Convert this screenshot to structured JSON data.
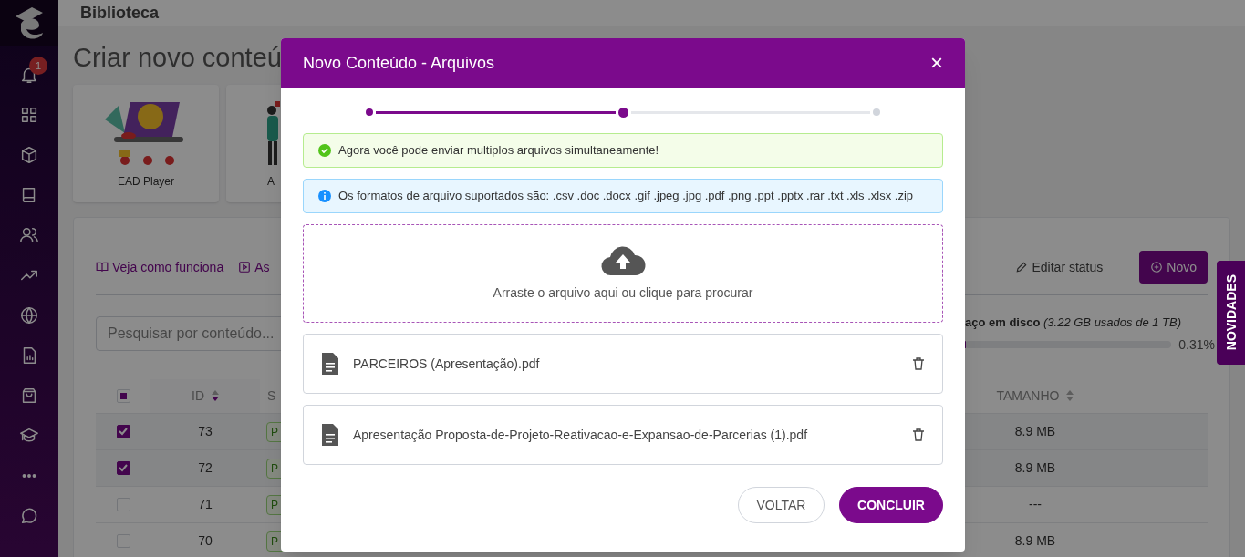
{
  "sidebar": {
    "notification_badge": "1",
    "items": [
      {
        "kind": "bell"
      },
      {
        "kind": "grid"
      },
      {
        "kind": "cube"
      },
      {
        "kind": "book"
      },
      {
        "kind": "users"
      },
      {
        "kind": "trend"
      },
      {
        "kind": "globe"
      },
      {
        "kind": "report"
      },
      {
        "kind": "bag"
      },
      {
        "kind": "cap"
      },
      {
        "kind": "dots"
      },
      {
        "kind": "chat"
      }
    ]
  },
  "header": {
    "title": "Biblioteca"
  },
  "page_title": "Criar novo conteú",
  "cards": [
    {
      "label": "EAD Player",
      "kind": "picture"
    },
    {
      "label": "A",
      "kind": "picture"
    }
  ],
  "toolbar": {
    "links": [
      "Veja como funciona",
      "As"
    ],
    "edit_status": "Editar status",
    "new_button": "Novo"
  },
  "search": {
    "placeholder": "Pesquisar por conteúdo..."
  },
  "disk": {
    "label": "**aço em disco** *(3.22 GB usados de 1 TB)*",
    "level": 0.0031,
    "reading": "0.31%"
  },
  "table": {
    "select_all": {
      "indeterminate": true
    },
    "columns": [
      "ID",
      "S",
      "TAMANHO"
    ],
    "rows": [
      {
        "checked": true,
        "id": "73",
        "status": "P",
        "size": "8.9 MB"
      },
      {
        "checked": true,
        "id": "72",
        "status": "P",
        "size": "8.9 MB"
      },
      {
        "checked": false,
        "id": "71",
        "status": "P",
        "size": "---"
      },
      {
        "checked": false,
        "id": "70",
        "status": "P",
        "size": "8.9 MB"
      }
    ]
  },
  "side_tab": "NOVIDADES",
  "modal": {
    "title": "Novo Conteúdo - Arquivos",
    "close": "×",
    "steps": [
      {
        "done": true,
        "current": false
      },
      {
        "done": true,
        "current": true
      },
      {
        "done": false,
        "current": false
      }
    ],
    "alerts": [
      {
        "kind": "success",
        "text": "Agora você pode enviar multiplos arquivos simultaneamente!"
      },
      {
        "kind": "info",
        "text": "Os formatos de arquivo suportados são: .csv .doc .docx .gif .jpeg .jpg .pdf .png .ppt .pptx .rar .txt .xls .xlsx .zip"
      }
    ],
    "dropzone": "Arraste o arquivo aqui ou clique para procurar",
    "files": [
      "PARCEIROS (Apresentação).pdf",
      "Apresentação Proposta-de-Projeto-Reativacao-e-Expansao-de-Parcerias (1).pdf"
    ],
    "buttons": [
      {
        "kind": "secondary",
        "label": "VOLTAR"
      },
      {
        "kind": "primary",
        "label": "CONCLUIR"
      }
    ]
  }
}
